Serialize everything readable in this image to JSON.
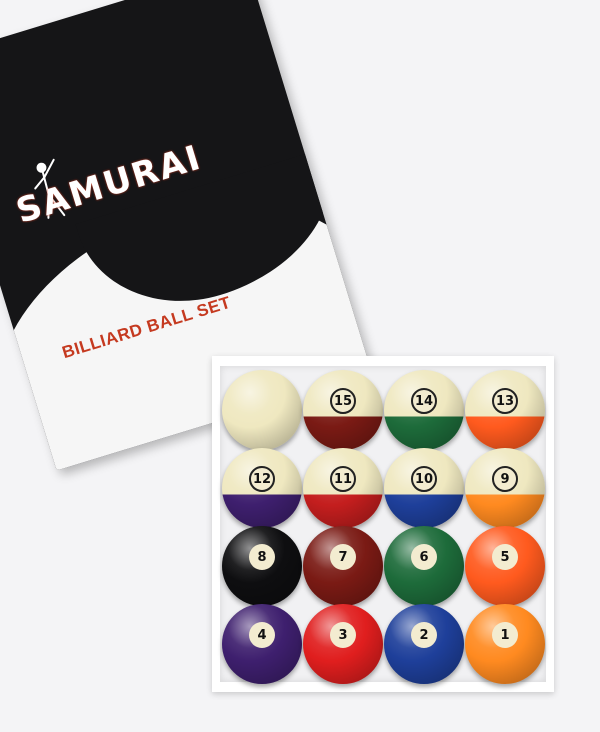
{
  "box": {
    "brand": "SAMURAI",
    "tagline": "BILLIARD BALL SET"
  },
  "colors": {
    "lid": "#151517",
    "brand_accent": "#d23a1f",
    "tray": "#ffffff",
    "ball_cream": "#efe8c0"
  },
  "balls": [
    {
      "number": "",
      "type": "cue",
      "color": "#efe8c0"
    },
    {
      "number": "15",
      "type": "stripe",
      "color": "#7a1a14"
    },
    {
      "number": "14",
      "type": "stripe",
      "color": "#1d6b3a"
    },
    {
      "number": "13",
      "type": "stripe",
      "color": "#ff5a1e"
    },
    {
      "number": "12",
      "type": "stripe",
      "color": "#3e1f6e"
    },
    {
      "number": "11",
      "type": "stripe",
      "color": "#c41e1e"
    },
    {
      "number": "10",
      "type": "stripe",
      "color": "#1e3f9a"
    },
    {
      "number": "9",
      "type": "stripe",
      "color": "#ff8a20"
    },
    {
      "number": "8",
      "type": "solid",
      "color": "#0e0e10"
    },
    {
      "number": "7",
      "type": "solid",
      "color": "#7a1a14"
    },
    {
      "number": "6",
      "type": "solid",
      "color": "#1d6b3a"
    },
    {
      "number": "5",
      "type": "solid",
      "color": "#ff5a1e"
    },
    {
      "number": "4",
      "type": "solid",
      "color": "#3e1f6e"
    },
    {
      "number": "3",
      "type": "solid",
      "color": "#e01e1e"
    },
    {
      "number": "2",
      "type": "solid",
      "color": "#1e3f9a"
    },
    {
      "number": "1",
      "type": "solid",
      "color": "#ff8a20"
    }
  ]
}
